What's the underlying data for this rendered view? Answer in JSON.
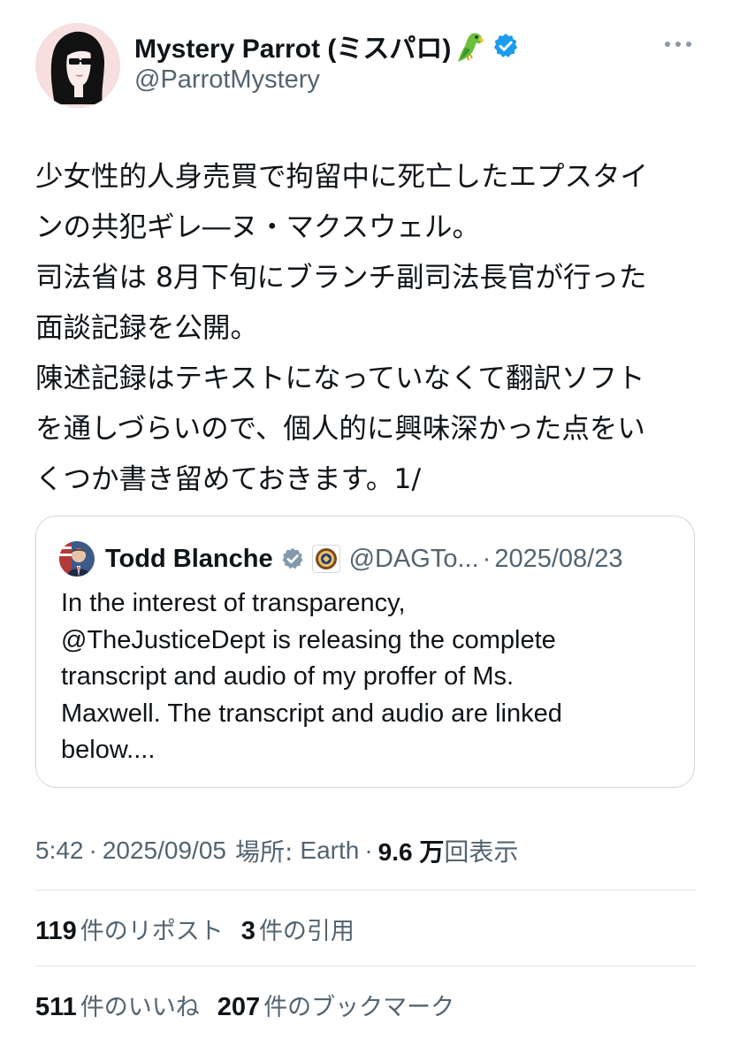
{
  "author": {
    "display_name": "Mystery Parrot (ミスパロ)",
    "handle": "@ParrotMystery",
    "avatar_icon": "woman-with-sunglasses-avatar",
    "badge_icon": "parrot-emoji",
    "verified_color": "#1d9bf0"
  },
  "post": {
    "lines": [
      "少女性的人身売買で拘留中に死亡したエプスタイ",
      "ンの共犯ギレ―ヌ・マクスウェル。",
      "司法省は 8月下旬にブランチ副司法長官が行った",
      "面談記録を公開。",
      "陳述記録はテキストになっていなくて翻訳ソフト",
      "を通しづらいので、個人的に興味深かった点をい",
      "くつか書き留めておきます。1/"
    ]
  },
  "quote": {
    "name": "Todd Blanche",
    "handle": "@DAGTo...",
    "separator": "·",
    "date": "2025/08/23",
    "verified_color": "#829aab",
    "lines": [
      "In the interest of transparency,",
      "@TheJusticeDept is releasing the complete",
      "transcript and audio of my proffer of Ms.",
      "Maxwell. The transcript and audio are linked",
      "below...."
    ]
  },
  "meta": {
    "time": "5:42",
    "dot": "·",
    "date": "2025/09/05",
    "location_label": "場所:",
    "location": "Earth",
    "views_count": "9.6 万",
    "views_label": "回表示"
  },
  "stats": {
    "reposts_count": "119",
    "reposts_label": "件のリポスト",
    "quotes_count": "3",
    "quotes_label": "件の引用",
    "likes_count": "511",
    "likes_label": "件のいいね",
    "bookmarks_count": "207",
    "bookmarks_label": "件のブックマーク"
  },
  "colors": {
    "text_primary": "#0f1419",
    "text_secondary": "#536471",
    "border": "#cfd9de"
  }
}
